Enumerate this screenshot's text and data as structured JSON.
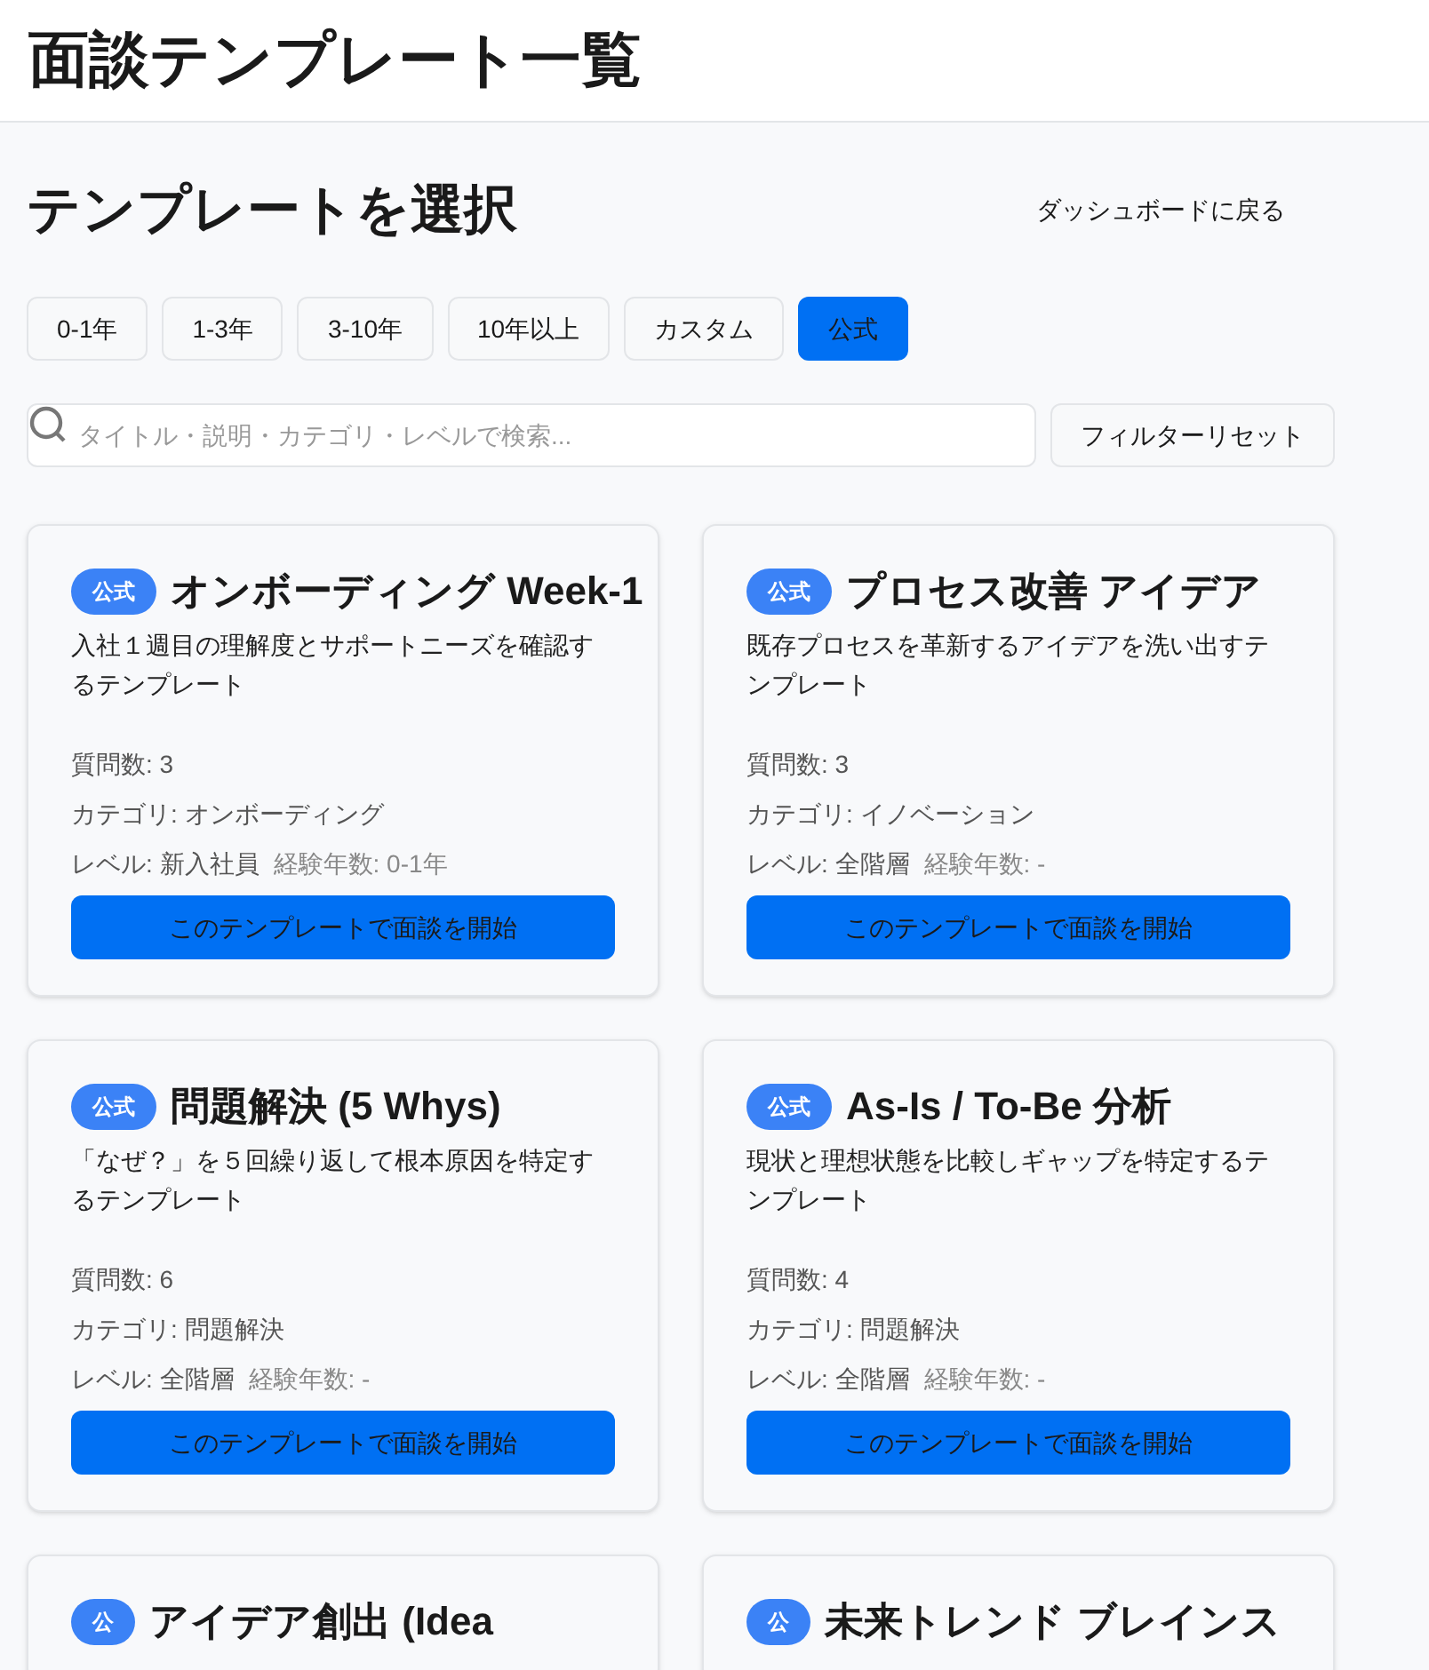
{
  "header": {
    "title": "面談テンプレート一覧"
  },
  "page": {
    "title": "テンプレートを選択",
    "back_button": "ダッシュボードに戻る"
  },
  "filters": [
    {
      "label": "0-1年",
      "selected": false
    },
    {
      "label": "1-3年",
      "selected": false
    },
    {
      "label": "3-10年",
      "selected": false
    },
    {
      "label": "10年以上",
      "selected": false
    },
    {
      "label": "カスタム",
      "selected": false
    },
    {
      "label": "公式",
      "selected": true
    }
  ],
  "search": {
    "placeholder": "タイトル・説明・カテゴリ・レベルで検索..."
  },
  "reset_button": "フィルターリセット",
  "templates": [
    {
      "badge": "公式",
      "title": "オンボーディング Week-1",
      "description": "入社１週目の理解度とサポートニーズを確認するテンプレート",
      "questions": "質問数: 3",
      "category": "カテゴリ: オンボーディング",
      "level": "レベル: 新入社員",
      "experience": "経験年数: 0-1年",
      "button": "このテンプレートで面談を開始"
    },
    {
      "badge": "公式",
      "title": "プロセス改善 アイデア",
      "description": "既存プロセスを革新するアイデアを洗い出すテンプレート",
      "questions": "質問数: 3",
      "category": "カテゴリ: イノベーション",
      "level": "レベル: 全階層",
      "experience": "経験年数: -",
      "button": "このテンプレートで面談を開始"
    },
    {
      "badge": "公式",
      "title": "問題解決 (5 Whys)",
      "description": "「なぜ？」を５回繰り返して根本原因を特定するテンプレート",
      "questions": "質問数: 6",
      "category": "カテゴリ: 問題解決",
      "level": "レベル: 全階層",
      "experience": "経験年数: -",
      "button": "このテンプレートで面談を開始"
    },
    {
      "badge": "公式",
      "title": "As-Is / To-Be 分析",
      "description": "現状と理想状態を比較しギャップを特定するテンプレート",
      "questions": "質問数: 4",
      "category": "カテゴリ: 問題解決",
      "level": "レベル: 全階層",
      "experience": "経験年数: -",
      "button": "このテンプレートで面談を開始"
    },
    {
      "badge": "公",
      "title": "アイデア創出 (Idea"
    },
    {
      "badge": "公",
      "title": "未来トレンド ブレインス"
    }
  ]
}
